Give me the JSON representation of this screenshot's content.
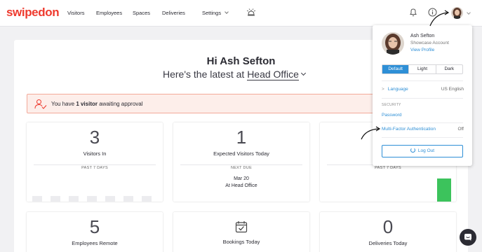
{
  "app": {
    "brand": "swipedon",
    "brand_color": "#ee3a2e",
    "accent_color": "#2e8fd6"
  },
  "nav": {
    "items": [
      {
        "label": "Visitors"
      },
      {
        "label": "Employees"
      },
      {
        "label": "Spaces"
      },
      {
        "label": "Deliveries"
      },
      {
        "label": "Settings"
      }
    ],
    "icons": [
      "reception-bell-icon",
      "notification-bell-icon",
      "info-icon",
      "avatar",
      "chevron-down-icon"
    ]
  },
  "greeting": {
    "hi": "Hi Ash Sefton",
    "latest_prefix": "Here's the latest at",
    "location": "Head Office"
  },
  "alert": {
    "prefix": "You have",
    "highlight": "1 visitor",
    "suffix": "awaiting approval",
    "icon": "user-check-icon"
  },
  "cards": {
    "visitors_in": {
      "value": "3",
      "label": "Visitors In",
      "period": "PAST 7 DAYS"
    },
    "expected": {
      "value": "1",
      "label": "Expected Visitors Today",
      "next_due_label": "NEXT DUE",
      "next_due_date": "Mar 20",
      "next_due_place": "At Head Office"
    },
    "third": {
      "period": "PAST 7 DAYS"
    },
    "employees_remote": {
      "value": "5",
      "label": "Employees Remote"
    },
    "bookings_today": {
      "label": "Bookings Today",
      "icon": "calendar-check-icon"
    },
    "deliveries_today": {
      "value": "0",
      "label": "Deliveries Today"
    }
  },
  "profile_menu": {
    "name": "Ash Sefton",
    "account": "Showcase Account",
    "view_profile": "View Profile",
    "themes": [
      "Default",
      "Light",
      "Dark"
    ],
    "active_theme": "Default",
    "language_label": "Language",
    "language_value": "US English",
    "security_heading": "SECURITY",
    "password": "Password",
    "mfa_label": "Multi-Factor Authentication",
    "mfa_value": "Off",
    "logout": "Log Out"
  }
}
